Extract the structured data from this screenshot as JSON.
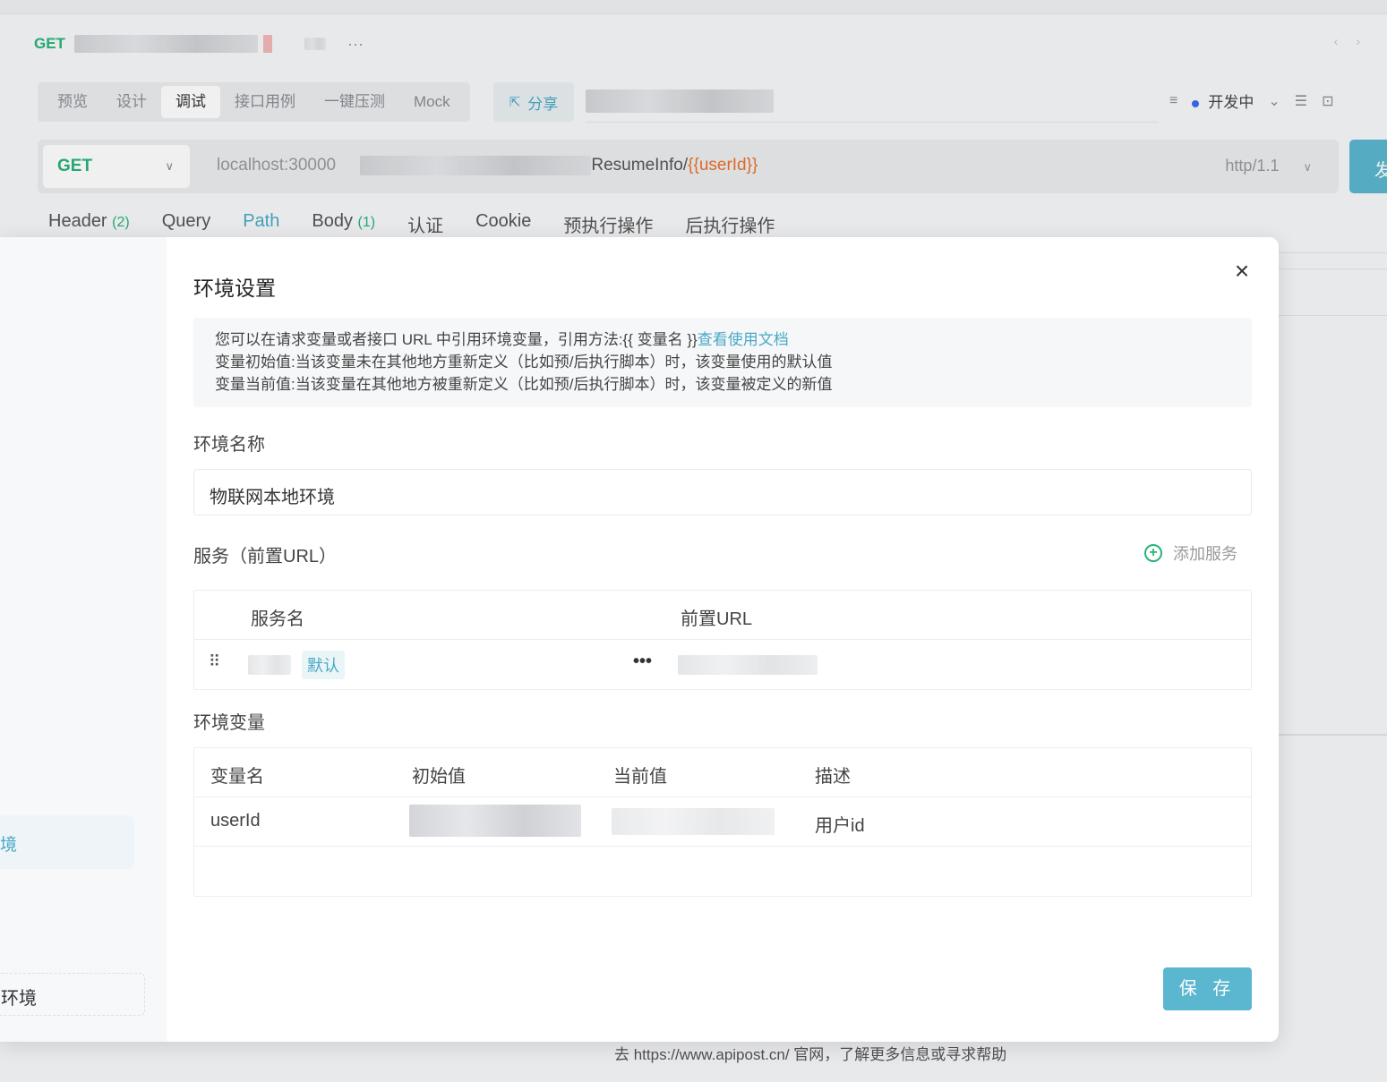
{
  "tab": {
    "method": "GET"
  },
  "modes": [
    "预览",
    "设计",
    "调试",
    "接口用例",
    "一键压测",
    "Mock"
  ],
  "share_label": "分享",
  "env_status": "开发中",
  "url": {
    "method": "GET",
    "host": "localhost:30000",
    "path": "ResumeInfo/",
    "variable": "{{userId}}",
    "protocol": "http/1.1"
  },
  "send_label": "发",
  "req_tabs": {
    "header": "Header",
    "header_count": "(2)",
    "query": "Query",
    "path": "Path",
    "body": "Body",
    "body_count": "(1)",
    "auth": "认证",
    "cookie": "Cookie",
    "pre": "预执行操作",
    "post": "后执行操作"
  },
  "help_text": "去 https://www.apipost.cn/ 官网，了解更多信息或寻求帮助",
  "modal": {
    "title": "环境设置",
    "info": {
      "line1": "您可以在请求变量或者接口 URL 中引用环境变量，引用方法:{{ 变量名 }}",
      "link": "查看使用文档",
      "line2": "变量初始值:当该变量未在其他地方重新定义（比如预/后执行脚本）时，该变量使用的默认值",
      "line3": "变量当前值:当该变量在其他地方被重新定义（比如预/后执行脚本）时，该变量被定义的新值"
    },
    "env_name_label": "环境名称",
    "env_name_value": "物联网本地环境",
    "service_label": "服务（前置URL）",
    "add_service": "添加服务",
    "service_table": {
      "headers": [
        "服务名",
        "前置URL"
      ],
      "default_tag": "默认",
      "more": "•••"
    },
    "vars_label": "环境变量",
    "vars_table": {
      "headers": [
        "变量名",
        "初始值",
        "当前值",
        "描述"
      ],
      "rows": [
        {
          "name": "userId",
          "description": "用户id"
        }
      ]
    },
    "save_label": "保 存",
    "side_active": "境",
    "side_bottom": "环境"
  }
}
